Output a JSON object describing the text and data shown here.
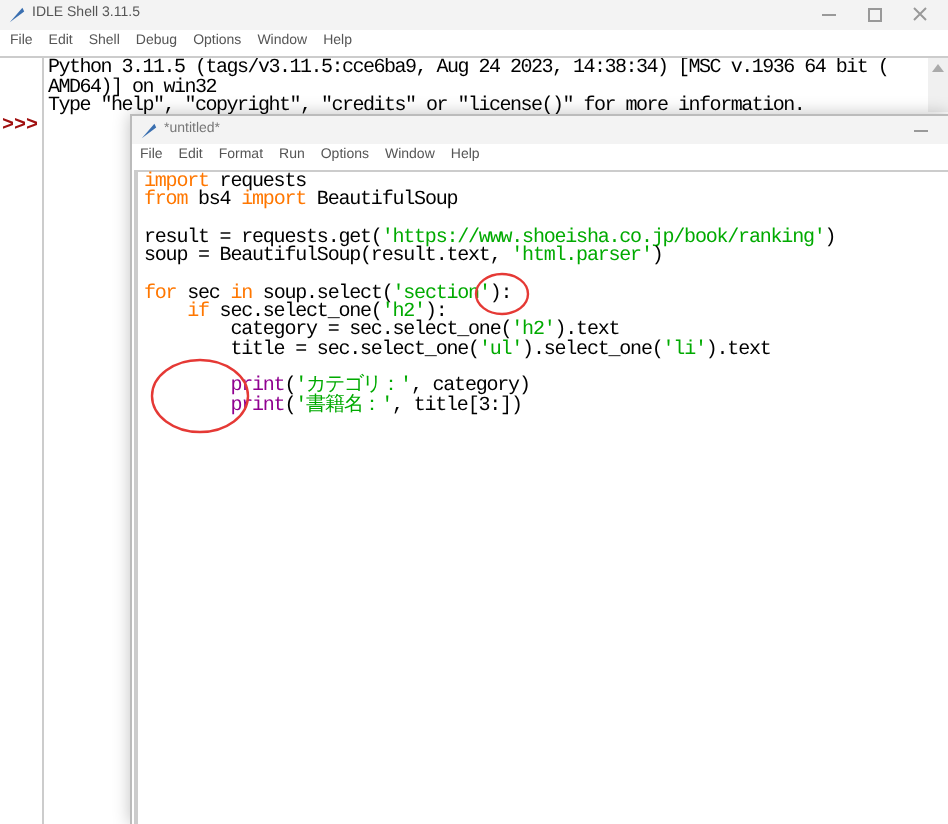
{
  "shell": {
    "title": "IDLE Shell 3.11.5",
    "menu": [
      "File",
      "Edit",
      "Shell",
      "Debug",
      "Options",
      "Window",
      "Help"
    ],
    "output": [
      "Python 3.11.5 (tags/v3.11.5:cce6ba9, Aug 24 2023, 14:38:34) [MSC v.1936 64 bit (",
      "AMD64)] on win32",
      "Type \"help\", \"copyright\", \"credits\" or \"license()\" for more information."
    ],
    "prompt": ">>>"
  },
  "editor": {
    "title": "*untitled*",
    "menu": [
      "File",
      "Edit",
      "Format",
      "Run",
      "Options",
      "Window",
      "Help"
    ],
    "code": [
      {
        "kind": "code",
        "tokens": [
          {
            "kind": "keyword",
            "text": "import"
          },
          {
            "kind": "plain",
            "text": " requests"
          }
        ]
      },
      {
        "kind": "code",
        "tokens": [
          {
            "kind": "keyword",
            "text": "from"
          },
          {
            "kind": "plain",
            "text": " bs4 "
          },
          {
            "kind": "keyword",
            "text": "import"
          },
          {
            "kind": "plain",
            "text": " BeautifulSoup"
          }
        ]
      },
      {
        "kind": "blank"
      },
      {
        "kind": "code",
        "tokens": [
          {
            "kind": "plain",
            "text": "result = requests.get("
          },
          {
            "kind": "string",
            "text": "'https://www.shoeisha.co.jp/book/ranking'"
          },
          {
            "kind": "plain",
            "text": ")"
          }
        ]
      },
      {
        "kind": "code",
        "tokens": [
          {
            "kind": "plain",
            "text": "soup = BeautifulSoup(result.text, "
          },
          {
            "kind": "string",
            "text": "'html.parser'"
          },
          {
            "kind": "plain",
            "text": ")"
          }
        ]
      },
      {
        "kind": "blank"
      },
      {
        "kind": "code",
        "tokens": [
          {
            "kind": "keyword",
            "text": "for"
          },
          {
            "kind": "plain",
            "text": " sec "
          },
          {
            "kind": "keyword",
            "text": "in"
          },
          {
            "kind": "plain",
            "text": " soup.select("
          },
          {
            "kind": "string",
            "text": "'section'"
          },
          {
            "kind": "plain",
            "text": "):"
          }
        ]
      },
      {
        "kind": "code",
        "tokens": [
          {
            "kind": "keyword",
            "text": "    if"
          },
          {
            "kind": "plain",
            "text": " sec.select_one("
          },
          {
            "kind": "string",
            "text": "'h2'"
          },
          {
            "kind": "plain",
            "text": "):"
          }
        ]
      },
      {
        "kind": "code",
        "tokens": [
          {
            "kind": "plain",
            "text": "        category = sec.select_one("
          },
          {
            "kind": "string",
            "text": "'h2'"
          },
          {
            "kind": "plain",
            "text": ").text"
          }
        ]
      },
      {
        "kind": "code",
        "tokens": [
          {
            "kind": "plain",
            "text": "        title = sec.select_one("
          },
          {
            "kind": "string",
            "text": "'ul'"
          },
          {
            "kind": "plain",
            "text": ").select_one("
          },
          {
            "kind": "string",
            "text": "'li'"
          },
          {
            "kind": "plain",
            "text": ").text"
          }
        ]
      },
      {
        "kind": "blank"
      },
      {
        "kind": "code",
        "tokens": [
          {
            "kind": "builtin",
            "text": "        print"
          },
          {
            "kind": "plain",
            "text": "("
          },
          {
            "kind": "string",
            "text": "'カテゴリ：'"
          },
          {
            "kind": "plain",
            "text": ", category)"
          }
        ]
      },
      {
        "kind": "code",
        "tokens": [
          {
            "kind": "builtin",
            "text": "        print"
          },
          {
            "kind": "plain",
            "text": "("
          },
          {
            "kind": "string",
            "text": "'書籍名：'"
          },
          {
            "kind": "plain",
            "text": ", title[3:])"
          }
        ]
      }
    ]
  }
}
